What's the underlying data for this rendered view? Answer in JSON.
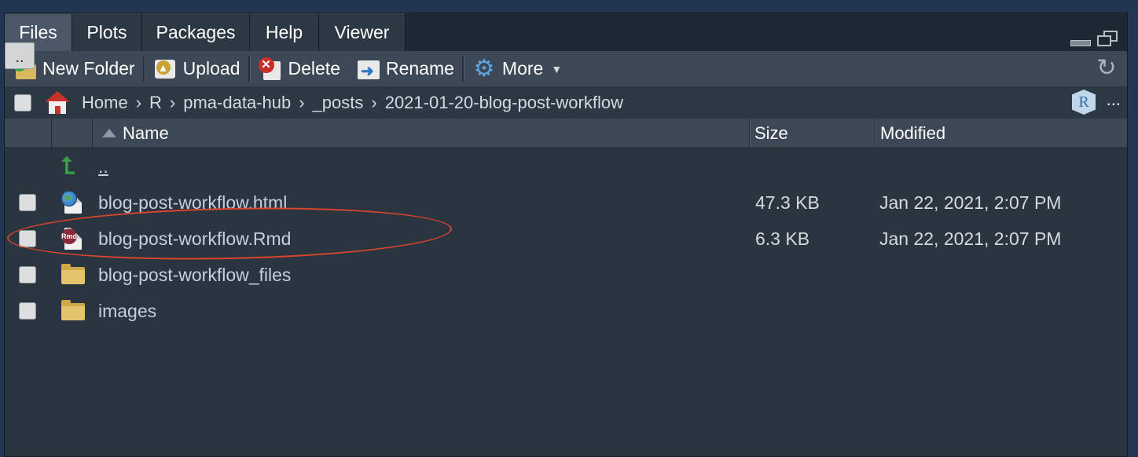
{
  "tabs": [
    {
      "label": "Files",
      "active": true
    },
    {
      "label": "Plots"
    },
    {
      "label": "Packages"
    },
    {
      "label": "Help"
    },
    {
      "label": "Viewer"
    }
  ],
  "tooltip": "..",
  "toolbar": {
    "new_folder": "New Folder",
    "upload": "Upload",
    "delete": "Delete",
    "rename": "Rename",
    "more": "More"
  },
  "breadcrumb": {
    "home": "Home",
    "parts": [
      "R",
      "pma-data-hub",
      "_posts",
      "2021-01-20-blog-post-workflow"
    ],
    "project_icon": "R",
    "overflow": "..."
  },
  "columns": {
    "name": "Name",
    "size": "Size",
    "modified": "Modified"
  },
  "files": [
    {
      "name": "..",
      "type": "parent",
      "size": "",
      "modified": ""
    },
    {
      "name": "blog-post-workflow.html",
      "type": "html",
      "size": "47.3 KB",
      "modified": "Jan 22, 2021, 2:07 PM"
    },
    {
      "name": "blog-post-workflow.Rmd",
      "type": "rmd",
      "size": "6.3 KB",
      "modified": "Jan 22, 2021, 2:07 PM",
      "highlighted": true
    },
    {
      "name": "blog-post-workflow_files",
      "type": "folder",
      "size": "",
      "modified": ""
    },
    {
      "name": "images",
      "type": "folder",
      "size": "",
      "modified": ""
    }
  ],
  "icons": {
    "rmd_badge": "Rmd"
  },
  "colors": {
    "highlight_oval": "#d9452e",
    "link_text": "#c4d0e2",
    "panel_bg": "#2a3540"
  }
}
